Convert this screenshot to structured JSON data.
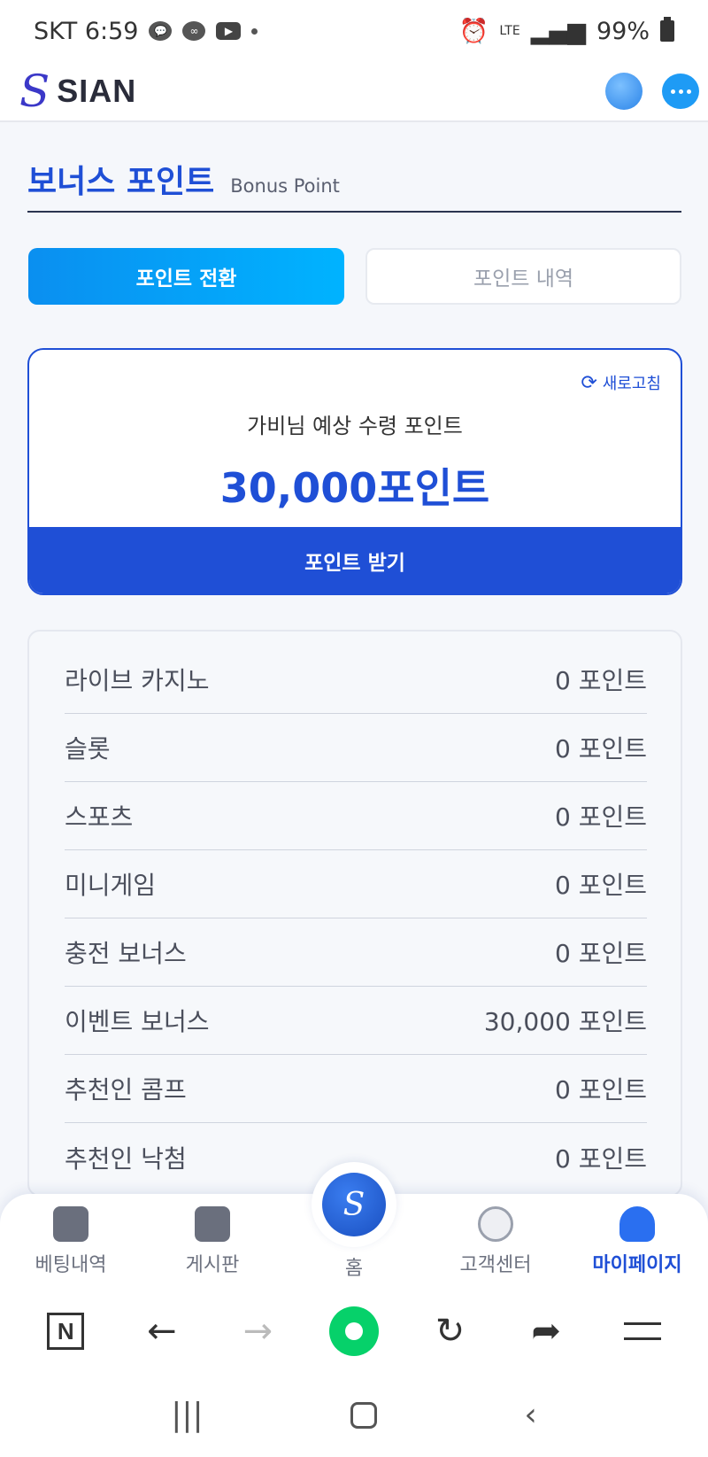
{
  "status_bar": {
    "carrier_time": "SKT 6:59",
    "network": "LTE",
    "battery": "99%"
  },
  "header": {
    "logo_mark": "S",
    "logo_text": "SIAN"
  },
  "page": {
    "title": "보너스 포인트",
    "subtitle": "Bonus Point"
  },
  "tabs": [
    {
      "label": "포인트 전환",
      "active": true
    },
    {
      "label": "포인트 내역",
      "active": false
    }
  ],
  "card": {
    "refresh_label": "새로고침",
    "label": "가비님 예상 수령 포인트",
    "value": "30,000포인트",
    "button": "포인트 받기"
  },
  "breakdown": [
    {
      "name": "라이브 카지노",
      "value": "0 포인트"
    },
    {
      "name": "슬롯",
      "value": "0 포인트"
    },
    {
      "name": "스포츠",
      "value": "0 포인트"
    },
    {
      "name": "미니게임",
      "value": "0 포인트"
    },
    {
      "name": "충전 보너스",
      "value": "0 포인트"
    },
    {
      "name": "이벤트 보너스",
      "value": "30,000 포인트"
    },
    {
      "name": "추천인 콤프",
      "value": "0 포인트"
    },
    {
      "name": "추천인 낙첨",
      "value": "0 포인트"
    }
  ],
  "bottom_nav": {
    "betting": "베팅내역",
    "board": "게시판",
    "home": "홈",
    "support": "고객센터",
    "mypage": "마이페이지"
  },
  "browser": {
    "n_label": "N"
  }
}
